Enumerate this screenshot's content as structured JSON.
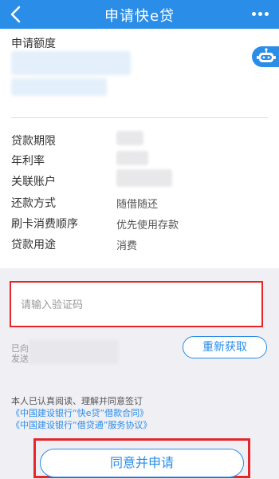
{
  "header": {
    "title": "申请快e贷",
    "back_icon": "chevron-left-icon",
    "more_icon": "more-dots-icon"
  },
  "quota": {
    "label": "申请额度",
    "robot_icon": "robot-icon"
  },
  "details": [
    {
      "label": "贷款期限",
      "value": ""
    },
    {
      "label": "年利率",
      "value": ""
    },
    {
      "label": "关联账户",
      "value": ""
    },
    {
      "label": "还款方式",
      "value": "随借随还"
    },
    {
      "label": "刷卡消费顺序",
      "value": "优先使用存款"
    },
    {
      "label": "贷款用途",
      "value": "消费"
    }
  ],
  "verification": {
    "placeholder": "请输入验证码",
    "sent_prefix": "已向",
    "sent_suffix": "发送",
    "resend_label": "重新获取"
  },
  "agreement": {
    "text": "本人已认真阅读、理解并同意签订",
    "link1": "《中国建设银行“快e贷”借款合同》",
    "link2": "《中国建设银行“借贷通”服务协议》"
  },
  "submit_label": "同意并申请",
  "colors": {
    "brand": "#2a8de8",
    "highlight": "#e5262b",
    "background": "#efeff4"
  }
}
